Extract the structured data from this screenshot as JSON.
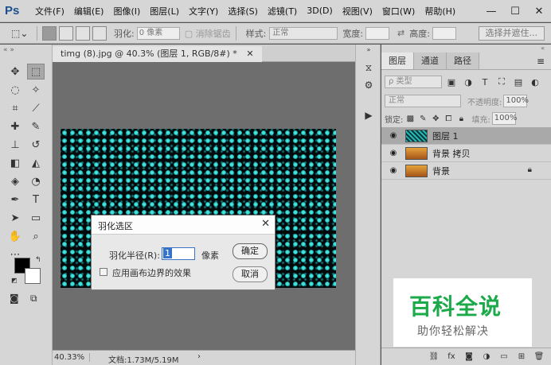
{
  "app": {
    "logo": "Ps",
    "menu": [
      "文件(F)",
      "编辑(E)",
      "图像(I)",
      "图层(L)",
      "文字(Y)",
      "选择(S)",
      "滤镜(T)",
      "3D(D)",
      "视图(V)",
      "窗口(W)",
      "帮助(H)"
    ],
    "window_controls": [
      "—",
      "☐",
      "✕"
    ]
  },
  "options": {
    "feather_label": "羽化:",
    "feather_value": "0 像素",
    "anti_alias_label": "消除锯齿",
    "style_label": "样式:",
    "style_value": "正常",
    "width_label": "宽度:",
    "height_label": "高度:",
    "select_mask_button": "选择并遮住..."
  },
  "document": {
    "tab_title": "timg (8).jpg @ 40.3% (图层 1, RGB/8#) *",
    "zoom": "40.33%",
    "doc_size": "文档:1.73M/5.19M",
    "arrow": "›"
  },
  "layers_panel": {
    "tabs": [
      "图层",
      "通道",
      "路径"
    ],
    "active_tab": 0,
    "filter_type": "ρ 类型",
    "blend_mode": "正常",
    "opacity_label": "不透明度:",
    "opacity_value": "100%",
    "lock_label": "锁定:",
    "fill_label": "填充:",
    "fill_value": "100%",
    "layers": [
      {
        "name": "图层 1",
        "selected": true,
        "thumb": "teal",
        "locked": false
      },
      {
        "name": "背景 拷贝",
        "selected": false,
        "thumb": "orange",
        "locked": false
      },
      {
        "name": "背景",
        "selected": false,
        "thumb": "orange",
        "locked": true
      }
    ]
  },
  "dialog": {
    "title": "羽化选区",
    "radius_label": "羽化半径(R):",
    "radius_value": "1",
    "unit": "像素",
    "checkbox_label": "应用画布边界的效果",
    "ok": "确定",
    "cancel": "取消"
  },
  "watermark": {
    "main": "百科全说",
    "sub": "助你轻松解决"
  }
}
